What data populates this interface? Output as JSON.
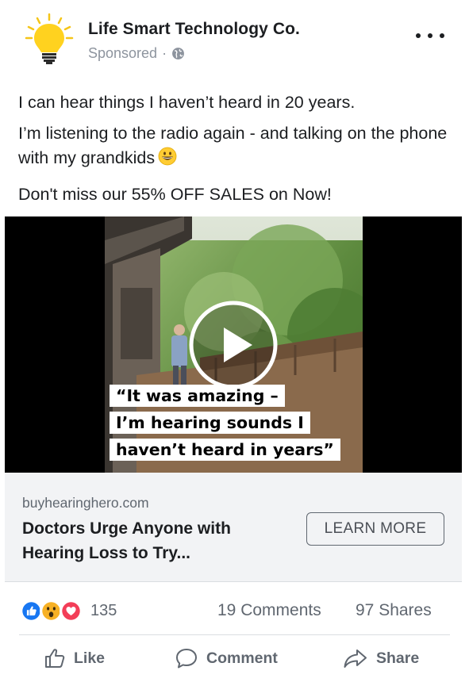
{
  "post": {
    "page_name": "Life Smart Technology Co.",
    "sponsored_label": "Sponsored",
    "separator": "·",
    "body_line1": "I can hear things I haven’t heard in 20 years.",
    "body_line2": "I’m listening to the radio again - and talking on the phone with my grandkids",
    "body_line3": "Don't miss our 55% OFF SALES on Now!",
    "emoji": "grinning-face"
  },
  "video": {
    "caption_line1": "“It was amazing –",
    "caption_line2": "I’m hearing sounds I",
    "caption_line3": "haven’t heard in years”"
  },
  "link_card": {
    "domain": "buyhearinghero.com",
    "title": "Doctors Urge Anyone with Hearing Loss to Try...",
    "cta_label": "LEARN MORE"
  },
  "engagement": {
    "reaction_count": "135",
    "reaction_icons": [
      "like-reaction",
      "wow-reaction",
      "love-reaction"
    ],
    "comments": "19 Comments",
    "shares": "97 Shares"
  },
  "actions": {
    "like": "Like",
    "comment": "Comment",
    "share": "Share"
  },
  "colors": {
    "like_blue": "#1877f2",
    "love_red": "#f33e58",
    "wow_yellow": "#f7b125",
    "muted_text": "#606770",
    "card_bg": "#f2f3f5"
  }
}
